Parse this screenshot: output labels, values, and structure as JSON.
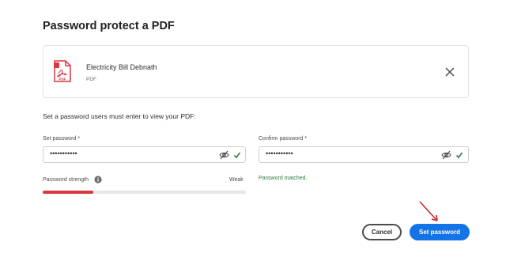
{
  "dialog": {
    "title": "Password protect a PDF"
  },
  "file": {
    "name": "Electricity Bill Debnath",
    "type": "PDF",
    "icon_label": "PDF"
  },
  "instruction": "Set a password users must enter to view your PDF:",
  "set_password": {
    "label": "Set password",
    "required_mark": "*",
    "value_masked": "•••••••••••"
  },
  "confirm_password": {
    "label": "Confirm password",
    "required_mark": "*",
    "value_masked": "•••••••••••"
  },
  "strength": {
    "label": "Password strength",
    "value": "Weak",
    "level_fraction": 0.25
  },
  "match_message": "Password matched.",
  "buttons": {
    "cancel": "Cancel",
    "submit": "Set password"
  },
  "colors": {
    "accent": "#1473e6",
    "weak": "#d7373f",
    "success": "#2d7d3a"
  }
}
